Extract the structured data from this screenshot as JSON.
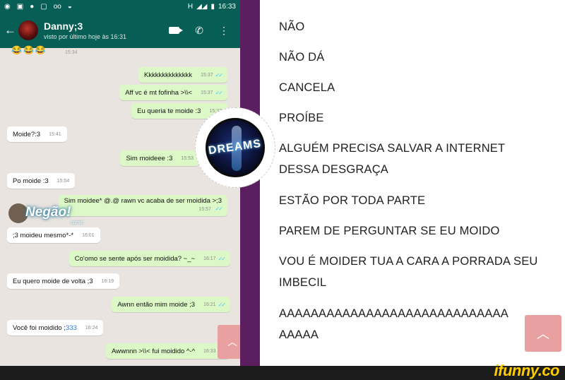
{
  "status_bar": {
    "left_icons": [
      "whatsapp-icon",
      "message-icon",
      "dot-icon",
      "gallery-icon",
      "voicemail-icon",
      "pokeball-icon"
    ],
    "signal": "H",
    "time": "16:33"
  },
  "chat_header": {
    "contact_name": "Danny;3",
    "last_seen": "visto por último hoje às 16:31"
  },
  "chat": {
    "top_emojis": "😂😂😂",
    "top_time": "15:34",
    "messages": [
      {
        "text": "Kkkkkkkkkkkkkk",
        "time": "15:37",
        "dir": "out"
      },
      {
        "text": "Aff vc é mt fofinha >\\\\<",
        "time": "15:37",
        "dir": "out"
      },
      {
        "text": "Eu queria te moide :3",
        "time": "15:37",
        "dir": "out"
      },
      {
        "text": "Moide?:3",
        "time": "15:41",
        "dir": "in"
      },
      {
        "text": "Sim moideee :3",
        "time": "15:53",
        "dir": "out"
      },
      {
        "text": "Po moide :3",
        "time": "15:54",
        "dir": "in"
      },
      {
        "text": "Sim moidee* @.@ rawn vc acaba de ser moidida >;3",
        "time": "15:57",
        "dir": "out"
      },
      {
        "text": ";3 moideu mesmo*-*",
        "time": "16:01",
        "dir": "in"
      },
      {
        "text": "Co'omo se sente após ser moidida? ~_~",
        "time": "16:17",
        "dir": "out"
      },
      {
        "text": "Eu quero moide de volta ;3",
        "time": "16:19",
        "dir": "in"
      },
      {
        "text": "Awnn então mim moide ;3",
        "time": "16:21",
        "dir": "out"
      },
      {
        "text": "Você foi moidido ;",
        "num": "333",
        "time": "16:24",
        "dir": "in"
      },
      {
        "text": "Awwnnn >\\\\< fui moidido ^-^",
        "time": "16:33",
        "dir": "out"
      }
    ],
    "watermark": "Negão!",
    "watermark_sub": "comic"
  },
  "logo": {
    "text": "DREAMS"
  },
  "rant_lines": [
    "NÃO",
    "NÃO DÁ",
    "CANCELA",
    "PROÍBE",
    "ALGUÉM PRECISA SALVAR A INTERNET",
    "DESSA DESGRAÇA",
    "ESTÃO POR TODA PARTE",
    "PAREM DE PERGUNTAR SE EU MOIDO",
    "VOU É MOIDER TUA A CARA A PORRADA SEU",
    "IMBECIL",
    "AAAAAAAAAAAAAAAAAAAAAAAAAAAAA",
    "AAAAA"
  ],
  "buttons": {
    "scroll_up_icon": "chevron-up-icon"
  },
  "brand": {
    "site": "ifunny.co",
    "accent": "#ffcc00",
    "divider": "#5b1f5f",
    "whatsapp_green": "#075e54"
  }
}
